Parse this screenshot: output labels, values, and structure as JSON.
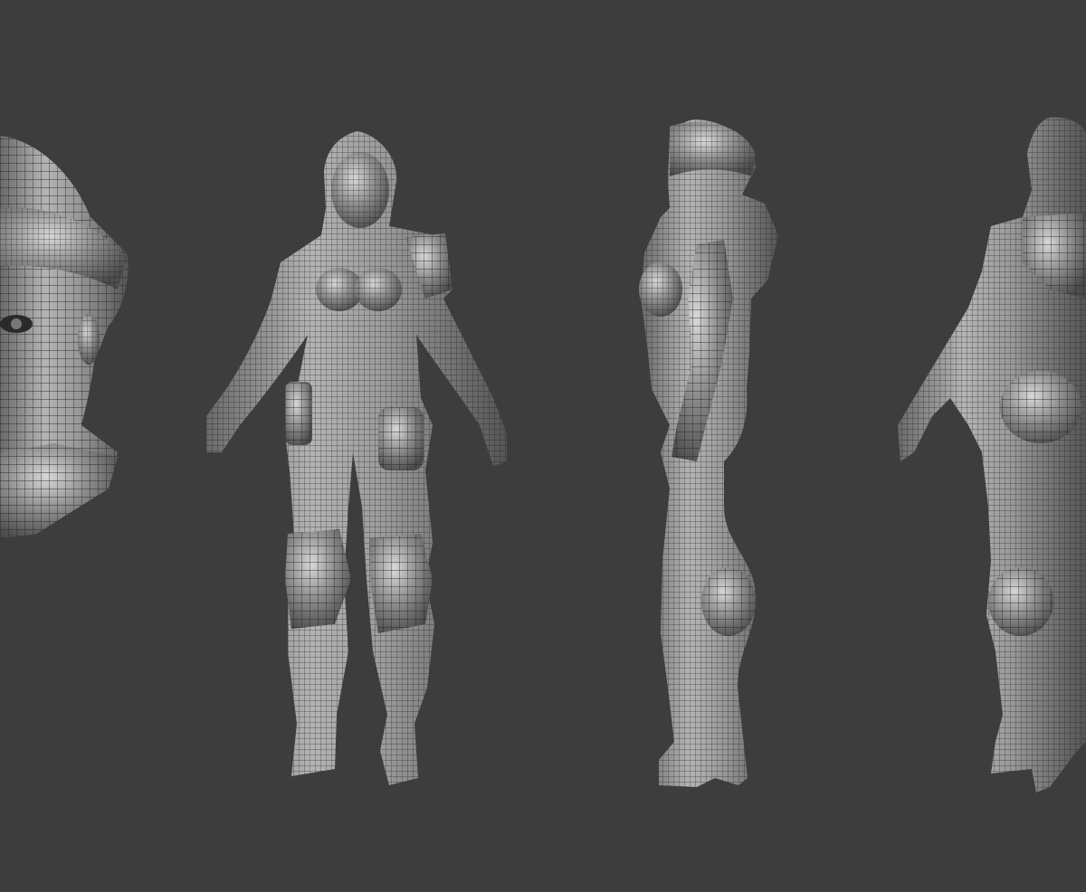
{
  "scene": {
    "background": "#3d3d3d",
    "mesh_fill": "#8c8c8c",
    "mesh_shadow": "#5a5a5a",
    "mesh_highlight": "#d8d8d8",
    "wire_color": "#1f1f1f",
    "views": [
      {
        "name": "head-closeup"
      },
      {
        "name": "front"
      },
      {
        "name": "side"
      },
      {
        "name": "three-quarter-back"
      }
    ]
  }
}
